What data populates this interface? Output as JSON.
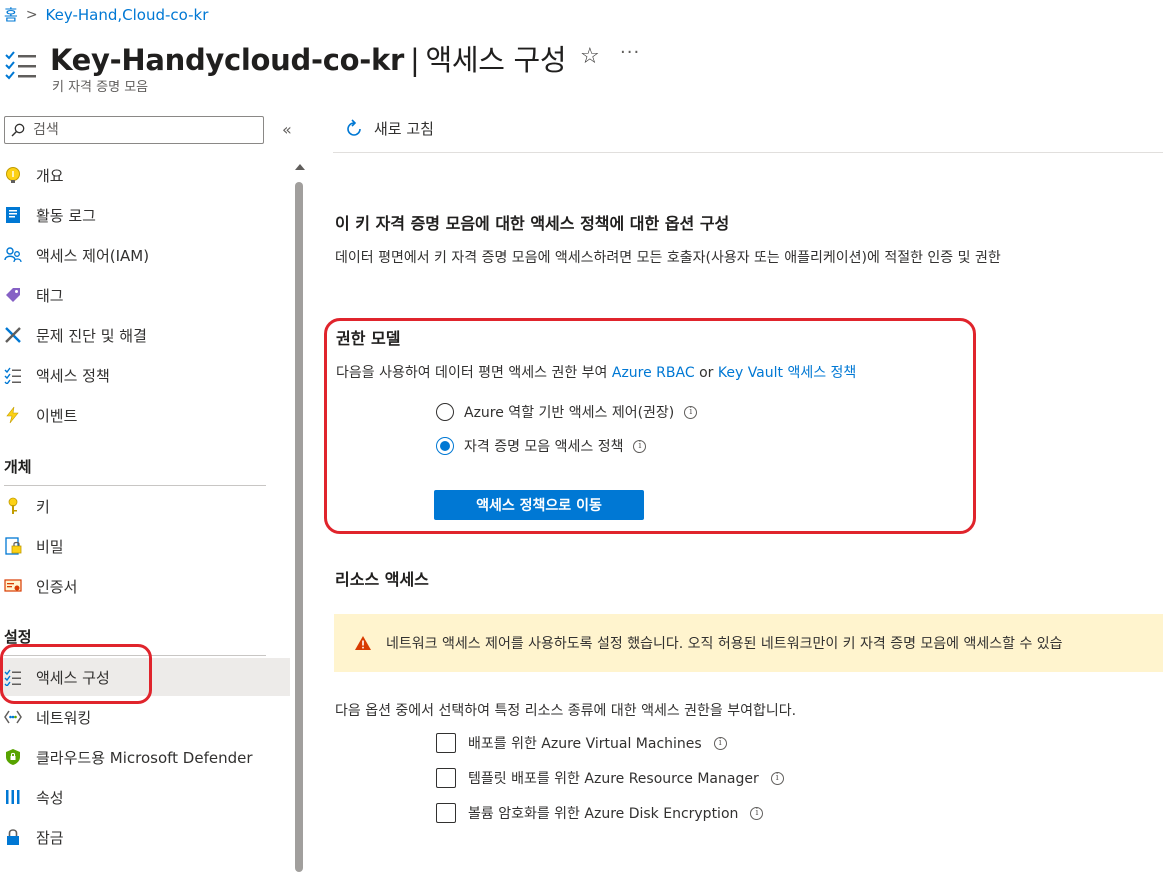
{
  "breadcrumb": {
    "home": "홈",
    "resource": "Key-Hand,Cloud-co-kr"
  },
  "header": {
    "title_main": "Key-Handycloud-co-kr",
    "title_section": "액세스 구성",
    "subtitle": "키 자격 증명 모음"
  },
  "sidebar": {
    "search_placeholder": "검색",
    "items_top": [
      {
        "label": "개요",
        "icon": "overview-icon"
      },
      {
        "label": "활동 로그",
        "icon": "activity-log-icon"
      },
      {
        "label": "액세스 제어(IAM)",
        "icon": "iam-icon"
      },
      {
        "label": "태그",
        "icon": "tag-icon"
      },
      {
        "label": "문제 진단 및 해결",
        "icon": "diagnose-icon"
      },
      {
        "label": "액세스 정책",
        "icon": "access-policy-icon"
      },
      {
        "label": "이벤트",
        "icon": "events-icon"
      }
    ],
    "section_objects": "개체",
    "items_objects": [
      {
        "label": "키",
        "icon": "key-icon"
      },
      {
        "label": "비밀",
        "icon": "secret-icon"
      },
      {
        "label": "인증서",
        "icon": "certificate-icon"
      }
    ],
    "section_settings": "설정",
    "items_settings": [
      {
        "label": "액세스 구성",
        "icon": "access-config-icon"
      },
      {
        "label": "네트워킹",
        "icon": "networking-icon"
      },
      {
        "label": "클라우드용 Microsoft Defender",
        "icon": "defender-icon"
      },
      {
        "label": "속성",
        "icon": "properties-icon"
      },
      {
        "label": "잠금",
        "icon": "lock-icon"
      }
    ]
  },
  "toolbar": {
    "refresh_label": "새로 고침"
  },
  "content": {
    "heading": "이 키 자격 증명 모음에 대한 액세스 정책에 대한 옵션 구성",
    "description": "데이터 평면에서 키 자격 증명 모음에 액세스하려면 모든 호출자(사용자 또는 애플리케이션)에 적절한 인증 및 권한",
    "permission_model": {
      "title": "권한 모델",
      "desc_prefix": "다음을 사용하여 데이터 평면 액세스 권한 부여",
      "link_rbac": "Azure RBAC",
      "or": "or",
      "link_kv": "Key Vault 액세스 정책",
      "option_rbac": "Azure 역할 기반 액세스 제어(권장)",
      "option_policy": "자격 증명 모음 액세스 정책",
      "selected": "option_policy",
      "button": "액세스 정책으로 이동"
    },
    "resource_access": {
      "title": "리소스 액세스",
      "warning": "네트워크 액세스 제어를 사용하도록 설정 했습니다. 오직 허용된 네트워크만이 키 자격 증명 모음에 액세스할 수 있습",
      "options_desc": "다음 옵션 중에서 선택하여 특정 리소스 종류에 대한 액세스 권한을 부여합니다.",
      "options": [
        {
          "label": "배포를 위한 Azure Virtual Machines",
          "checked": false
        },
        {
          "label": "템플릿 배포를 위한 Azure Resource Manager",
          "checked": false
        },
        {
          "label": "볼륨 암호화를 위한 Azure Disk Encryption",
          "checked": false
        }
      ]
    }
  },
  "colors": {
    "accent": "#0078d4",
    "highlight": "#e0242c",
    "warning_bg": "#fff4ce"
  }
}
